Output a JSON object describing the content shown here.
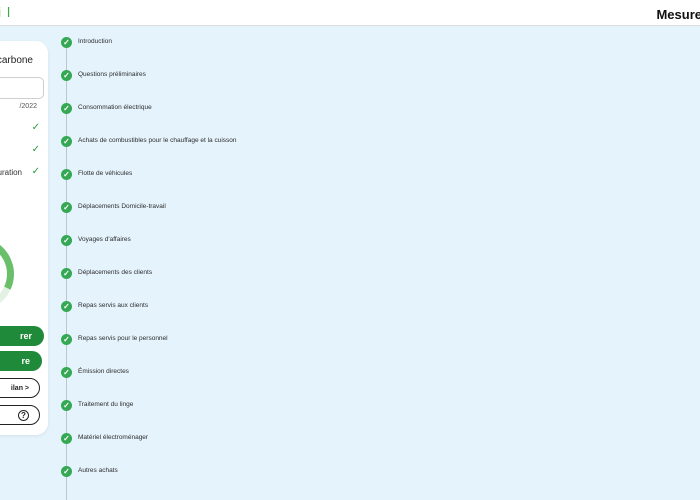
{
  "app": {
    "logo_text": "i l",
    "page_title": "Mesure"
  },
  "card": {
    "title": "carbone",
    "date": "/2022",
    "checklist": [
      {
        "label": "",
        "check": "✓"
      },
      {
        "label": "",
        "check": "✓"
      },
      {
        "label": "uration",
        "check": "✓"
      }
    ],
    "primary_button_label": "rer",
    "secondary_button_label": "re",
    "bilan_button_label": "ilan >",
    "help_icon": "?"
  },
  "steps": [
    "Introduction",
    "Questions préliminaires",
    "Consommation électrique",
    "Achats de combustibles pour le chauffage et la cuisson",
    "Flotte de véhicules",
    "Déplacements Domicile-travail",
    "Voyages d'affaires",
    "Déplacements des clients",
    "Repas servis aux clients",
    "Repas servis pour le personnel",
    "Émission directes",
    "Traitement du linge",
    "Matériel électroménager",
    "Autres achats"
  ],
  "colors": {
    "brand_green": "#3ea84a",
    "step_green": "#34a853",
    "button_green": "#1f8a3a",
    "background": "#e4f3fc"
  },
  "icons": {
    "step": "check-circle-icon",
    "help": "help-icon"
  }
}
